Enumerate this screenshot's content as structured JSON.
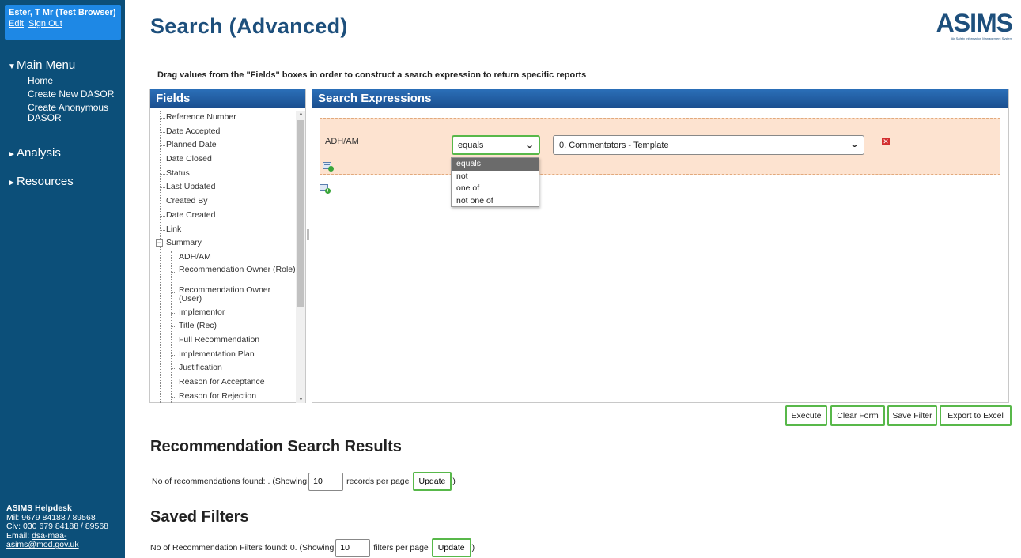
{
  "user": {
    "name": "Ester, T Mr (Test Browser)",
    "edit_label": "Edit",
    "signout_label": "Sign Out"
  },
  "sidebar": {
    "main_menu_label": "Main Menu",
    "items": [
      {
        "label": "Home"
      },
      {
        "label": "Create New DASOR"
      },
      {
        "label": "Create Anonymous DASOR"
      }
    ],
    "analysis_label": "Analysis",
    "resources_label": "Resources",
    "helpdesk": {
      "title": "ASIMS Helpdesk",
      "mil": "Mil: 9679 84188 / 89568",
      "civ": "Civ: 030 679 84188 / 89568",
      "email_prefix": "Email: ",
      "email": "dsa-maa-asims@mod.gov.uk"
    }
  },
  "page": {
    "title": "Search (Advanced)",
    "logo_text": "ASIMS",
    "logo_sub": "Air Safety Information Management System",
    "instruction": "Drag values from the \"Fields\" boxes in order to construct a search expression to return specific reports"
  },
  "fields_panel": {
    "header": "Fields",
    "top_items": [
      "Reference Number",
      "Date Accepted",
      "Planned Date",
      "Date Closed",
      "Status",
      "Last Updated",
      "Created By",
      "Date Created",
      "Link"
    ],
    "summary_label": "Summary",
    "summary_children": [
      "ADH/AM",
      "Recommendation Owner (Role)",
      "Recommendation Owner (User)",
      "Implementor",
      "Title (Rec)",
      "Full Recommendation",
      "Implementation Plan",
      "Justification",
      "Reason for Acceptance",
      "Reason for Rejection"
    ]
  },
  "expr_panel": {
    "header": "Search Expressions",
    "field_label": "ADH/AM",
    "operator_value": "equals",
    "value_selected": "0. Commentators - Template",
    "operator_options": [
      "equals",
      "not",
      "one of",
      "not one of"
    ]
  },
  "actions": {
    "execute": "Execute",
    "clear_form": "Clear Form",
    "save_filter": "Save Filter",
    "export_excel": "Export to Excel"
  },
  "results": {
    "title": "Recommendation Search Results",
    "found_text": "No of recommendations found: . (Showing",
    "per_page_value": "10",
    "per_page_suffix": "records per page",
    "update_label": "Update",
    "close_paren": ")"
  },
  "saved_filters": {
    "title": "Saved Filters",
    "found_text": "No of Recommendation Filters found: 0. (Showing",
    "per_page_value": "10",
    "per_page_suffix": "filters per page",
    "update_label": "Update",
    "close_paren": ")"
  },
  "colors": {
    "sidebar": "#0c4f79",
    "user_box": "#1e88e5",
    "title": "#1d4f7c",
    "header_blue": "#1a4e8e",
    "accent_green": "#58b84a",
    "expr_row": "#fde3d0"
  }
}
